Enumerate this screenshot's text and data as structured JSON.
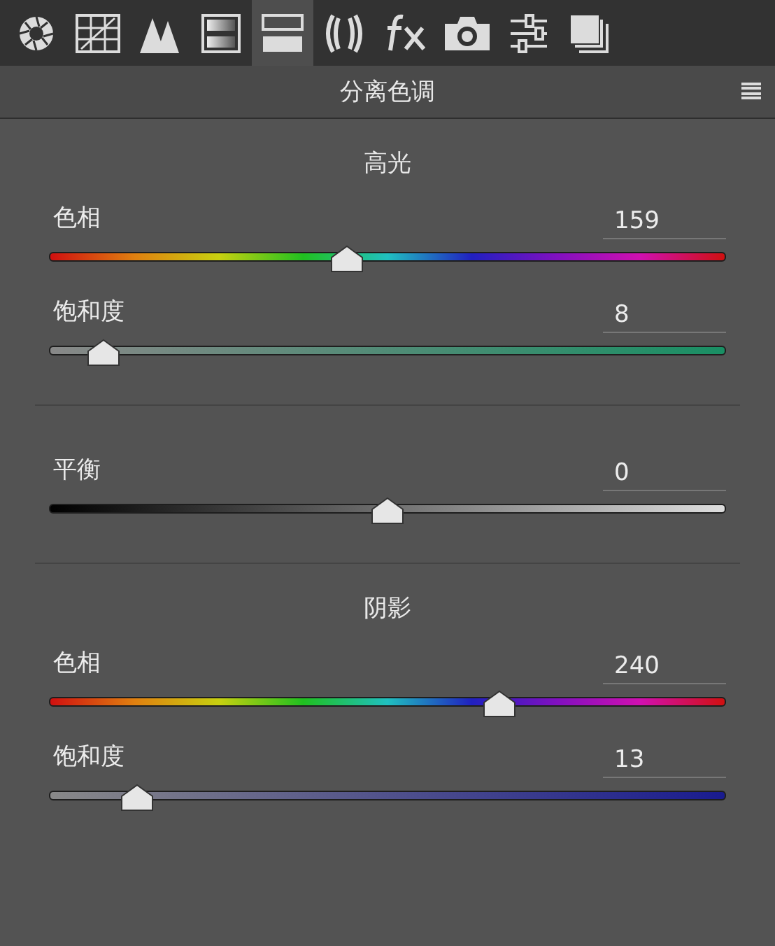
{
  "toolbar": {
    "tabs": [
      {
        "selected": false
      },
      {
        "selected": false
      },
      {
        "selected": false
      },
      {
        "selected": false
      },
      {
        "selected": true
      },
      {
        "selected": false
      },
      {
        "selected": false
      },
      {
        "selected": false
      },
      {
        "selected": false
      },
      {
        "selected": false
      }
    ]
  },
  "panel": {
    "title": "分离色调"
  },
  "sections": [
    {
      "heading": "高光",
      "sliders": [
        {
          "kind": "hue",
          "label": "色相",
          "value": "159",
          "level": 0.44
        },
        {
          "kind": "saturation",
          "label": "饱和度",
          "value": "8",
          "level": 0.08
        }
      ]
    },
    {
      "sliders": [
        {
          "kind": "balance",
          "label": "平衡",
          "value": "0",
          "level": 0.5
        }
      ]
    },
    {
      "heading": "阴影",
      "sliders": [
        {
          "kind": "hue",
          "label": "色相",
          "value": "240",
          "level": 0.665
        },
        {
          "kind": "saturation",
          "label": "饱和度",
          "value": "13",
          "level": 0.13
        }
      ]
    }
  ]
}
